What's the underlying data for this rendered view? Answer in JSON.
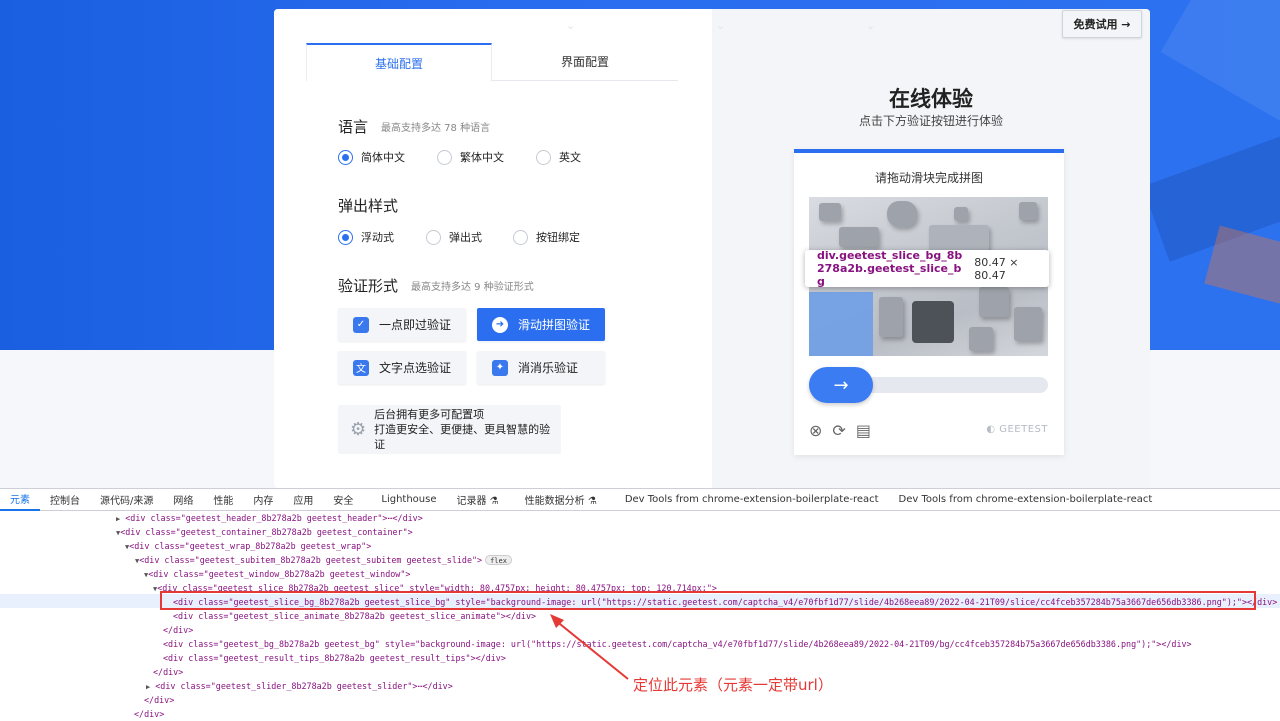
{
  "header": {
    "free_trial_label": "免费试用 →"
  },
  "config": {
    "tabs": [
      {
        "label": "基础配置"
      },
      {
        "label": "界面配置"
      }
    ],
    "language": {
      "title": "语言",
      "note": "最高支持多达 78 种语言",
      "options": [
        "简体中文",
        "繁体中文",
        "英文"
      ],
      "selected": "简体中文"
    },
    "popup": {
      "title": "弹出样式",
      "options": [
        "浮动式",
        "弹出式",
        "按钮绑定"
      ],
      "selected": "浮动式"
    },
    "verify": {
      "title": "验证形式",
      "note": "最高支持多达 9 种验证形式",
      "buttons": [
        {
          "label": "一点即过验证"
        },
        {
          "label": "滑动拼图验证"
        },
        {
          "label": "文字点选验证"
        },
        {
          "label": "消消乐验证"
        }
      ],
      "selected": "滑动拼图验证"
    },
    "more": {
      "line1": "后台拥有更多可配置项",
      "line2": "打造更安全、更便捷、更具智慧的验证"
    }
  },
  "demo": {
    "title": "在线体验",
    "subtitle": "点击下方验证按钮进行体验",
    "captcha": {
      "heading": "请拖动滑块完成拼图",
      "brand": "GEETEST"
    },
    "tooltip": {
      "class_name": "div.geetest_slice_bg_8b278a2b.geetest_slice_bg",
      "size": "80.47 × 80.47"
    }
  },
  "devtools": {
    "tabs": [
      "元素",
      "控制台",
      "源代码/来源",
      "网络",
      "性能",
      "内存",
      "应用",
      "安全",
      "Lighthouse",
      "记录器 ⚗",
      "性能数据分析 ⚗",
      "Dev Tools from chrome-extension-boilerplate-react",
      "Dev Tools from chrome-extension-boilerplate-react"
    ],
    "active_tab": "元素",
    "lines": [
      "<div class=\"geetest_header_8b278a2b geetest_header\">⋯</div>",
      "<div class=\"geetest_container_8b278a2b geetest_container\">",
      "<div class=\"geetest_wrap_8b278a2b geetest_wrap\">",
      "<div class=\"geetest_subitem_8b278a2b geetest_subitem geetest_slide\">",
      "<div class=\"geetest_window_8b278a2b geetest_window\">",
      "<div class=\"geetest_slice_8b278a2b geetest_slice\" style=\"width: 80.4757px; height: 80.4757px; top: 120.714px;\">",
      "<div class=\"geetest_slice_bg_8b278a2b geetest_slice_bg\" style=\"background-image: url(\"https://static.geetest.com/captcha_v4/e70fbf1d77/slide/4b268eea89/2022-04-21T09/slice/cc4fceb357284b75a3667de656db3386.png\");\"></div> == $0",
      "<div class=\"geetest_slice_animate_8b278a2b geetest_slice_animate\"></div>",
      "</div>",
      "<div class=\"geetest_bg_8b278a2b geetest_bg\" style=\"background-image: url(\"https://static.geetest.com/captcha_v4/e70fbf1d77/slide/4b268eea89/2022-04-21T09/bg/cc4fceb357284b75a3667de656db3386.png\");\"></div>",
      "<div class=\"geetest_result_tips_8b278a2b geetest_result_tips\"></div>",
      "</div>",
      "<div class=\"geetest_slider_8b278a2b geetest_slider\">⋯</div>",
      "</div>",
      "</div>"
    ],
    "flex_badge": "flex",
    "annotation": "定位此元素（元素一定带url）"
  },
  "colors": {
    "accent": "#2b6ff0",
    "annotation": "#e53935"
  },
  "icons": [
    "gear-icon",
    "arrow-right-icon",
    "close-circle-icon",
    "refresh-icon",
    "feedback-icon",
    "geetest-logo-icon"
  ]
}
